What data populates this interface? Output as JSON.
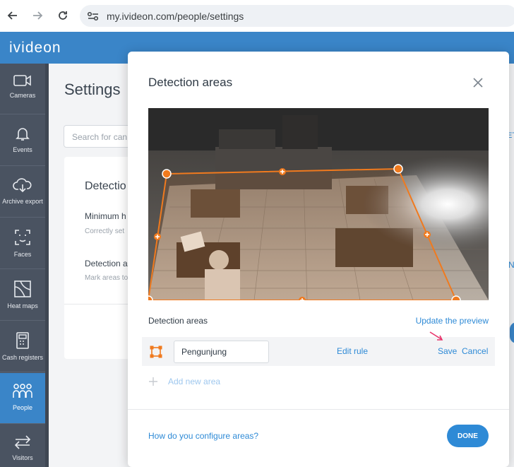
{
  "browser": {
    "url": "my.ivideon.com/people/settings"
  },
  "app": {
    "logo": "ivideon"
  },
  "sidebar": {
    "items": [
      {
        "label": "Cameras",
        "icon": "camera-icon",
        "active": false
      },
      {
        "label": "Events",
        "icon": "bell-icon",
        "active": false
      },
      {
        "label": "Archive export",
        "icon": "cloud-download-icon",
        "active": false
      },
      {
        "label": "Faces",
        "icon": "face-scan-icon",
        "active": false
      },
      {
        "label": "Heat maps",
        "icon": "heatmap-icon",
        "active": false
      },
      {
        "label": "Cash registers",
        "icon": "cash-register-icon",
        "active": false
      },
      {
        "label": "People",
        "icon": "people-icon",
        "active": true
      },
      {
        "label": "Visitors",
        "icon": "visitors-arrows-icon",
        "active": false
      }
    ]
  },
  "background": {
    "title": "Settings",
    "search_placeholder": "Search for can",
    "card_title": "Detectio",
    "min_label": "Minimum h",
    "min_sub": "Correctly set",
    "areas_label": "Detection a",
    "areas_sub": "Mark areas to",
    "right_edge_text": "ET",
    "right_edge_text2": "N"
  },
  "modal": {
    "title": "Detection areas",
    "areas_label": "Detection areas",
    "update_preview": "Update the preview",
    "area_name": "Pengunjung",
    "edit_rule": "Edit rule",
    "save": "Save",
    "cancel": "Cancel",
    "add_area": "Add new area",
    "help": "How do you configure areas?",
    "done": "DONE"
  },
  "colors": {
    "accent": "#2e8ad6",
    "header": "#3a85c8",
    "sidebar": "#4a5361",
    "zone": "#f07a1e",
    "arrow": "#e8336a"
  }
}
